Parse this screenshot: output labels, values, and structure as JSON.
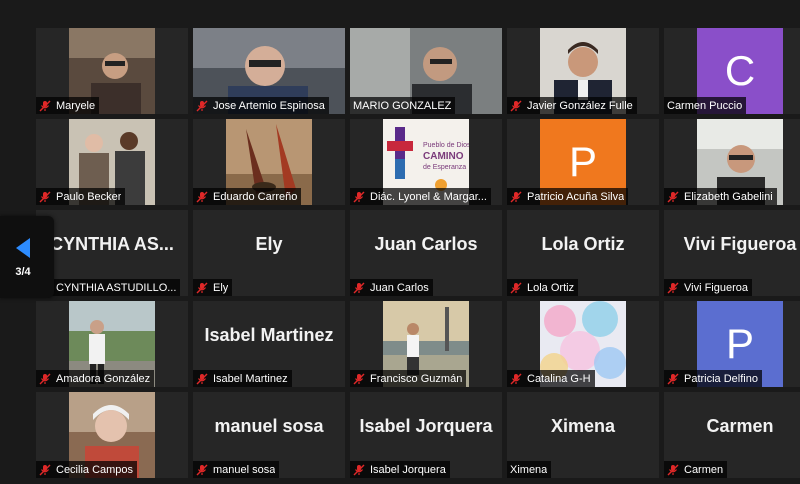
{
  "colors": {
    "accent_blue": "#2d8cff",
    "mic_muted_red": "#e02828",
    "tile_bg": "#262626"
  },
  "pager": {
    "label": "3/4"
  },
  "tiles": [
    {
      "name": "Maryele",
      "kind": "video"
    },
    {
      "name": "Jose Artemio Espinosa",
      "kind": "video"
    },
    {
      "name": "MARIO GONZALEZ",
      "kind": "video",
      "muted": false
    },
    {
      "name": "Javier González Fulle",
      "kind": "video"
    },
    {
      "name": "Carmen Puccio",
      "kind": "avatar",
      "initial": "C",
      "color": "#8a4fc9",
      "muted": false
    },
    {
      "name": "Paulo Becker",
      "kind": "video"
    },
    {
      "name": "Eduardo Carreño",
      "kind": "video"
    },
    {
      "name": "Diác. Lyonel & Margar...",
      "kind": "video"
    },
    {
      "name": "Patricio Acuña Silva",
      "kind": "avatar",
      "initial": "P",
      "color": "#f0781e"
    },
    {
      "name": "Elizabeth Gabelini",
      "kind": "video"
    },
    {
      "name": "CYNTHIA ASTUDILLO...",
      "display": "CYNTHIA AS...",
      "kind": "text"
    },
    {
      "name": "Ely",
      "display": "Ely",
      "kind": "text"
    },
    {
      "name": "Juan Carlos",
      "display": "Juan Carlos",
      "kind": "text"
    },
    {
      "name": "Lola Ortiz",
      "display": "Lola Ortiz",
      "kind": "text"
    },
    {
      "name": "Vivi Figueroa",
      "display": "Vivi Figueroa",
      "kind": "text"
    },
    {
      "name": "Amadora González",
      "kind": "video"
    },
    {
      "name": "Isabel Martinez",
      "display": "Isabel Martinez",
      "kind": "text"
    },
    {
      "name": "Francisco Guzmán",
      "kind": "video"
    },
    {
      "name": "Catalina G-H",
      "kind": "video"
    },
    {
      "name": "Patricia Delfino",
      "kind": "avatar",
      "initial": "P",
      "color": "#5b6ed0"
    },
    {
      "name": "Cecilia Campos",
      "kind": "video"
    },
    {
      "name": "manuel sosa",
      "display": "manuel sosa",
      "kind": "text"
    },
    {
      "name": "Isabel Jorquera",
      "display": "Isabel Jorquera",
      "kind": "text"
    },
    {
      "name": "Ximena",
      "display": "Ximena",
      "kind": "text",
      "muted": false
    },
    {
      "name": "Carmen",
      "display": "Carmen",
      "kind": "text"
    }
  ],
  "video_slots": {
    "embedded_poster_text": "Pueblo de Dios CAMINO de Esperanza"
  }
}
